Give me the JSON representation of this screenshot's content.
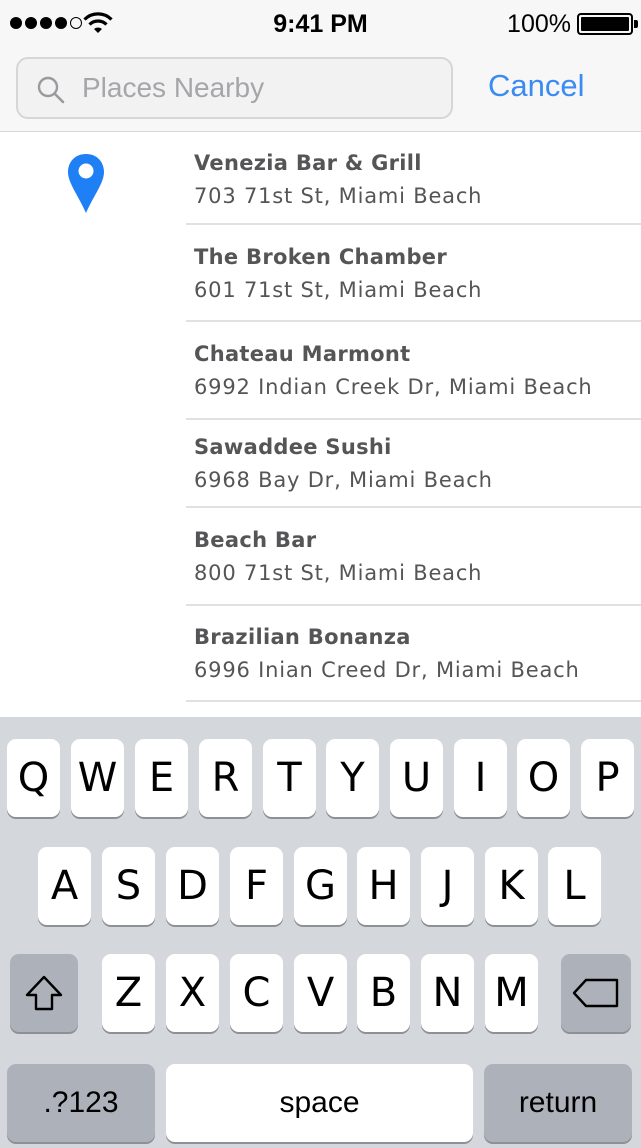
{
  "status_bar": {
    "signal_dots": 5,
    "signal_filled": 4,
    "time": "9:41 PM",
    "battery_percent": "100%",
    "battery_level": 1.0
  },
  "search": {
    "placeholder": "Places Nearby",
    "value": "",
    "cancel_label": "Cancel"
  },
  "colors": {
    "accent": "#3a8bf2",
    "pin": "#1f7ff5",
    "text": "#555558"
  },
  "results": [
    {
      "name": "Venezia Bar & Grill",
      "address": "703 71st St, Miami Beach"
    },
    {
      "name": "The Broken Chamber",
      "address": "601 71st St, Miami Beach"
    },
    {
      "name": "Chateau Marmont",
      "address": "6992 Indian Creek Dr, Miami Beach"
    },
    {
      "name": "Sawaddee Sushi",
      "address": "6968 Bay Dr, Miami Beach"
    },
    {
      "name": "Beach Bar",
      "address": "800 71st St, Miami Beach"
    },
    {
      "name": "Brazilian Bonanza",
      "address": "6996 Inian Creed Dr, Miami Beach"
    }
  ],
  "keyboard": {
    "row1": [
      "Q",
      "W",
      "E",
      "R",
      "T",
      "Y",
      "U",
      "I",
      "O",
      "P"
    ],
    "row2": [
      "A",
      "S",
      "D",
      "F",
      "G",
      "H",
      "J",
      "K",
      "L"
    ],
    "row3": [
      "Z",
      "X",
      "C",
      "V",
      "B",
      "N",
      "M"
    ],
    "numbers_label": ".?123",
    "space_label": "space",
    "return_label": "return"
  }
}
